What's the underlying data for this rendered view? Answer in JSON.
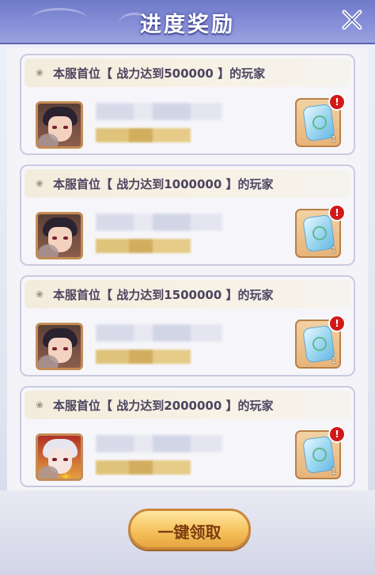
{
  "header": {
    "title": "进度奖励"
  },
  "cards": [
    {
      "title": "本服首位【 战力达到500000 】的玩家",
      "reward_qty": "1",
      "alert": "!"
    },
    {
      "title": "本服首位【 战力达到1000000 】的玩家",
      "reward_qty": "1",
      "alert": "!"
    },
    {
      "title": "本服首位【 战力达到1500000 】的玩家",
      "reward_qty": "1",
      "alert": "!"
    },
    {
      "title": "本服首位【 战力达到2000000 】的玩家",
      "reward_qty": "1",
      "alert": "!"
    }
  ],
  "footer": {
    "claim_label": "一键领取"
  },
  "icons": {
    "close": "close-icon",
    "lotus": "lotus-icon",
    "reward": "jade-token-icon",
    "alert": "exclamation-badge-icon"
  },
  "colors": {
    "header": "#7b84cf",
    "accent_gold": "#f6c25d",
    "alert_red": "#d01a1a"
  }
}
